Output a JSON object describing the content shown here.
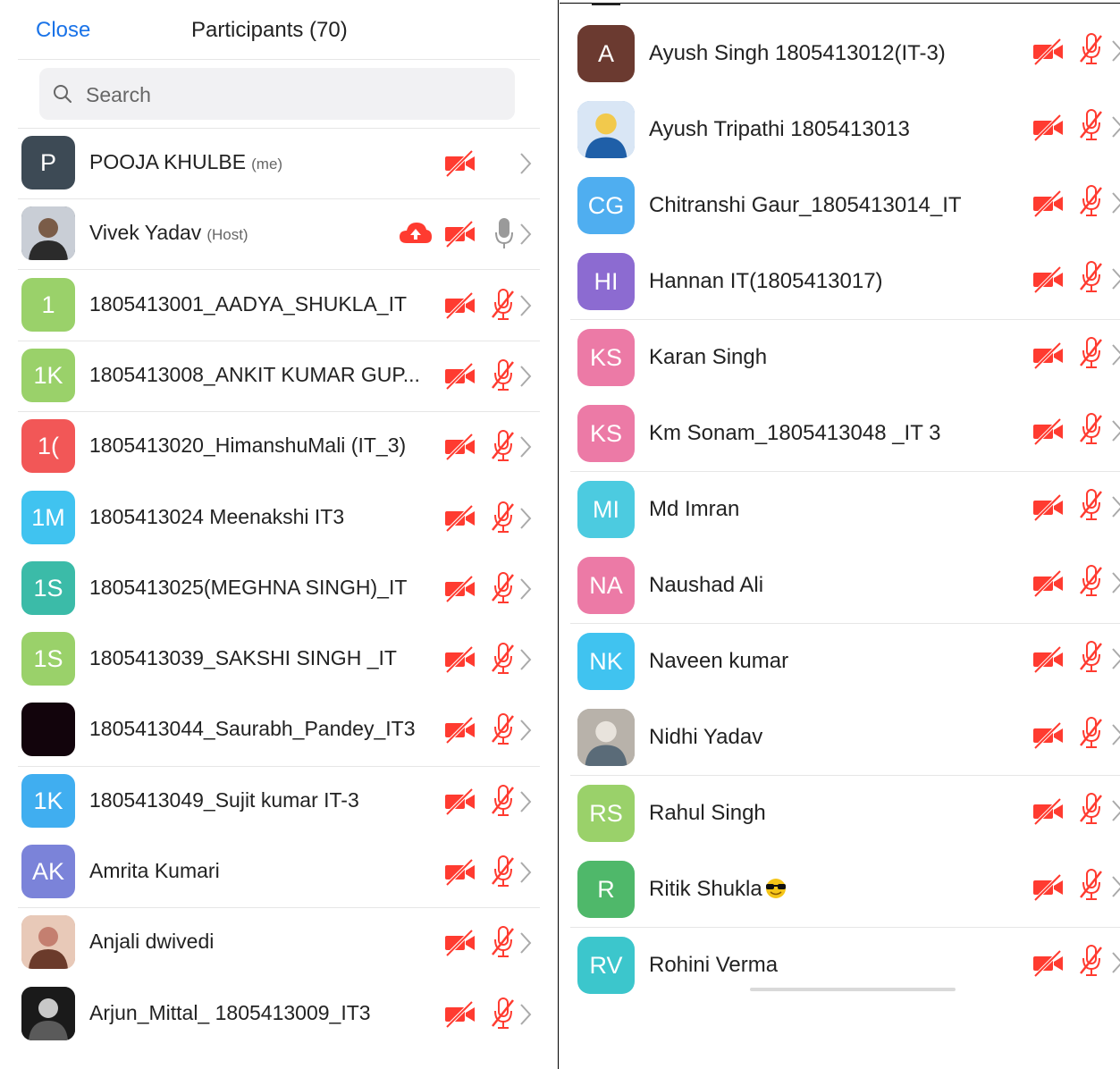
{
  "header": {
    "close_label": "Close",
    "title": "Participants (70)"
  },
  "search": {
    "placeholder": "Search"
  },
  "colors": {
    "accent": "#1a73e8",
    "muted_red": "#ff3b30",
    "gray_mic": "#9a9a9a"
  },
  "left_participants": [
    {
      "initials": "P",
      "name": "POOJA KHULBE",
      "tag": "(me)",
      "color": "#3d4a55",
      "avatar": "initials",
      "cloud": false,
      "mic": "none"
    },
    {
      "initials": "",
      "name": "Vivek Yadav",
      "tag": "(Host)",
      "color": "#4a5660",
      "avatar": "photo",
      "cloud": true,
      "mic": "gray"
    },
    {
      "initials": "1",
      "name": "1805413001_AADYA_SHUKLA_IT",
      "tag": "",
      "color": "#9ad16a",
      "avatar": "initials",
      "cloud": false,
      "mic": "muted"
    },
    {
      "initials": "1K",
      "name": "1805413008_ANKIT KUMAR GUP...",
      "tag": "",
      "color": "#9ad16a",
      "avatar": "initials",
      "cloud": false,
      "mic": "muted"
    },
    {
      "initials": "1(",
      "name": "1805413020_HimanshuMali (IT_3)",
      "tag": "",
      "color": "#f25757",
      "avatar": "initials",
      "cloud": false,
      "mic": "muted"
    },
    {
      "initials": "1M",
      "name": "1805413024 Meenakshi IT3",
      "tag": "",
      "color": "#40c3f0",
      "avatar": "initials",
      "cloud": false,
      "mic": "muted"
    },
    {
      "initials": "1S",
      "name": "1805413025(MEGHNA SINGH)_IT",
      "tag": "",
      "color": "#3bbba8",
      "avatar": "initials",
      "cloud": false,
      "mic": "muted"
    },
    {
      "initials": "1S",
      "name": "1805413039_SAKSHI SINGH _IT",
      "tag": "",
      "color": "#9ad16a",
      "avatar": "initials",
      "cloud": false,
      "mic": "muted"
    },
    {
      "initials": "",
      "name": "1805413044_Saurabh_Pandey_IT3",
      "tag": "",
      "color": "#12040c",
      "avatar": "initials",
      "cloud": false,
      "mic": "muted"
    },
    {
      "initials": "1K",
      "name": "1805413049_Sujit kumar IT-3",
      "tag": "",
      "color": "#40aef0",
      "avatar": "initials",
      "cloud": false,
      "mic": "muted"
    },
    {
      "initials": "AK",
      "name": "Amrita Kumari",
      "tag": "",
      "color": "#7b83d9",
      "avatar": "initials",
      "cloud": false,
      "mic": "muted"
    },
    {
      "initials": "",
      "name": "Anjali dwivedi",
      "tag": "",
      "color": "#c59a8a",
      "avatar": "photo",
      "cloud": false,
      "mic": "muted"
    },
    {
      "initials": "",
      "name": "Arjun_Mittal_ 1805413009_IT3",
      "tag": "",
      "color": "#2a2a2a",
      "avatar": "photo",
      "cloud": false,
      "mic": "muted"
    }
  ],
  "right_participants": [
    {
      "initials": "A",
      "name": "Ayush Singh 1805413012(IT-3)",
      "color": "#6b3a30",
      "avatar": "initials",
      "emoji": false
    },
    {
      "initials": "",
      "name": "Ayush Tripathi 1805413013",
      "color": "#8fb3d9",
      "avatar": "photo",
      "emoji": false
    },
    {
      "initials": "CG",
      "name": "Chitranshi Gaur_1805413014_IT",
      "color": "#4faef0",
      "avatar": "initials",
      "emoji": false
    },
    {
      "initials": "HI",
      "name": "Hannan IT(1805413017)",
      "color": "#8c6bd1",
      "avatar": "initials",
      "emoji": false
    },
    {
      "initials": "KS",
      "name": "Karan Singh",
      "color": "#ec7aa6",
      "avatar": "initials",
      "emoji": false
    },
    {
      "initials": "KS",
      "name": "Km Sonam_1805413048 _IT 3",
      "color": "#ec7aa6",
      "avatar": "initials",
      "emoji": false
    },
    {
      "initials": "MI",
      "name": "Md Imran",
      "color": "#4ccbe0",
      "avatar": "initials",
      "emoji": false
    },
    {
      "initials": "NA",
      "name": "Naushad Ali",
      "color": "#ec7aa6",
      "avatar": "initials",
      "emoji": false
    },
    {
      "initials": "NK",
      "name": "Naveen kumar",
      "color": "#40c3f0",
      "avatar": "initials",
      "emoji": false
    },
    {
      "initials": "",
      "name": "Nidhi Yadav",
      "color": "#a9a6a0",
      "avatar": "photo",
      "emoji": false
    },
    {
      "initials": "RS",
      "name": "Rahul Singh",
      "color": "#9ad16a",
      "avatar": "initials",
      "emoji": false
    },
    {
      "initials": "R",
      "name": "Ritik Shukla",
      "color": "#4fb86a",
      "avatar": "initials",
      "emoji": true
    },
    {
      "initials": "RV",
      "name": "Rohini Verma",
      "color": "#3cc6cc",
      "avatar": "initials",
      "emoji": false
    }
  ]
}
